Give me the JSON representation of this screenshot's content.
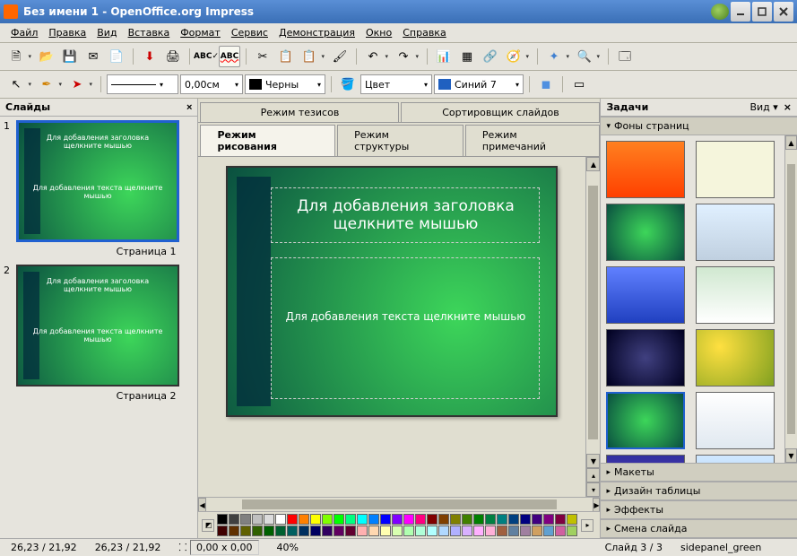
{
  "title": "Без имени 1 - OpenOffice.org Impress",
  "menu": [
    "Файл",
    "Правка",
    "Вид",
    "Вставка",
    "Формат",
    "Сервис",
    "Демонстрация",
    "Окно",
    "Справка"
  ],
  "toolbar2": {
    "width": "0,00см",
    "black": "Черны",
    "color": "Цвет",
    "blue": "Синий 7"
  },
  "slides": {
    "label": "Слайды",
    "items": [
      {
        "num": "1",
        "label": "Страница 1",
        "title": "Для добавления заголовка щелкните мышью",
        "text": "Для добавления текста щелкните мышью",
        "sel": true
      },
      {
        "num": "2",
        "label": "Страница 2",
        "title": "Для добавления заголовка щелкните мышью",
        "text": "Для добавления текста щелкните мышью",
        "sel": false
      }
    ]
  },
  "tabs_top": [
    "Режим тезисов",
    "Сортировщик слайдов"
  ],
  "tabs": [
    {
      "label": "Режим рисования",
      "active": true
    },
    {
      "label": "Режим структуры",
      "active": false
    },
    {
      "label": "Режим примечаний",
      "active": false
    }
  ],
  "canvas": {
    "title_placeholder": "Для добавления заголовка щелкните мышью",
    "text_placeholder": "Для добавления текста щелкните мышью"
  },
  "palette": [
    "#000000",
    "#404040",
    "#808080",
    "#c0c0c0",
    "#dcdcdc",
    "#ffffff",
    "#ff0000",
    "#ff8000",
    "#ffff00",
    "#80ff00",
    "#00ff00",
    "#00ff80",
    "#00ffff",
    "#0080ff",
    "#0000ff",
    "#8000ff",
    "#ff00ff",
    "#ff0080",
    "#800000",
    "#804000",
    "#808000",
    "#408000",
    "#008000",
    "#008040",
    "#008080",
    "#004080",
    "#000080",
    "#400080",
    "#800080",
    "#800040",
    "#c0c000",
    "#400000",
    "#603000",
    "#606000",
    "#306000",
    "#006000",
    "#006030",
    "#006060",
    "#003060",
    "#000060",
    "#300060",
    "#600060",
    "#600030",
    "#ffb0b0",
    "#ffd8b0",
    "#ffffb0",
    "#d8ffb0",
    "#b0ffb0",
    "#b0ffd8",
    "#b0ffff",
    "#b0d8ff",
    "#b0b0ff",
    "#d8b0ff",
    "#ffb0ff",
    "#ffb0d8",
    "#a06040",
    "#6080a0",
    "#a080a0",
    "#d0a060",
    "#60a0d0",
    "#d060a0",
    "#a0d060"
  ],
  "tasks": {
    "label": "Задачи",
    "view": "Вид",
    "sections": {
      "backgrounds": "Фоны страниц",
      "layouts": "Макеты",
      "tabledesign": "Дизайн таблицы",
      "effects": "Эффекты",
      "transition": "Смена слайда"
    },
    "bgs": [
      {
        "bg": "linear-gradient(#ff8020,#ff4000)",
        "sel": false
      },
      {
        "bg": "#f5f5dc",
        "sel": false
      },
      {
        "bg": "radial-gradient(circle,#3dd65a,#0a5040)",
        "sel": false
      },
      {
        "bg": "linear-gradient(#e0f0ff,#c0d0e0)",
        "sel": false
      },
      {
        "bg": "linear-gradient(#6080ff,#2040c0)",
        "sel": false
      },
      {
        "bg": "linear-gradient(#d0e8d0,#ffffff)",
        "sel": false
      },
      {
        "bg": "radial-gradient(circle at 50% 50%,#404080,#000020)",
        "sel": false
      },
      {
        "bg": "radial-gradient(circle at 30% 30%,#ffe040,#80a020) ",
        "sel": false
      },
      {
        "bg": "radial-gradient(circle,#3dd65a,#0a5040)",
        "sel": true
      },
      {
        "bg": "linear-gradient(#ffffff,#e0e8f0)",
        "sel": false
      },
      {
        "bg": "linear-gradient(#3030a0,#8040c0)",
        "sel": false
      },
      {
        "bg": "linear-gradient(#d0e8ff,#a0c8f0)",
        "sel": false
      }
    ]
  },
  "status": {
    "coords": "26,23 / 21,92",
    "size": "0,00 x 0,00",
    "zoom": "40%",
    "slide": "Слайд 3 / 3",
    "tpl": "sidepanel_green"
  }
}
